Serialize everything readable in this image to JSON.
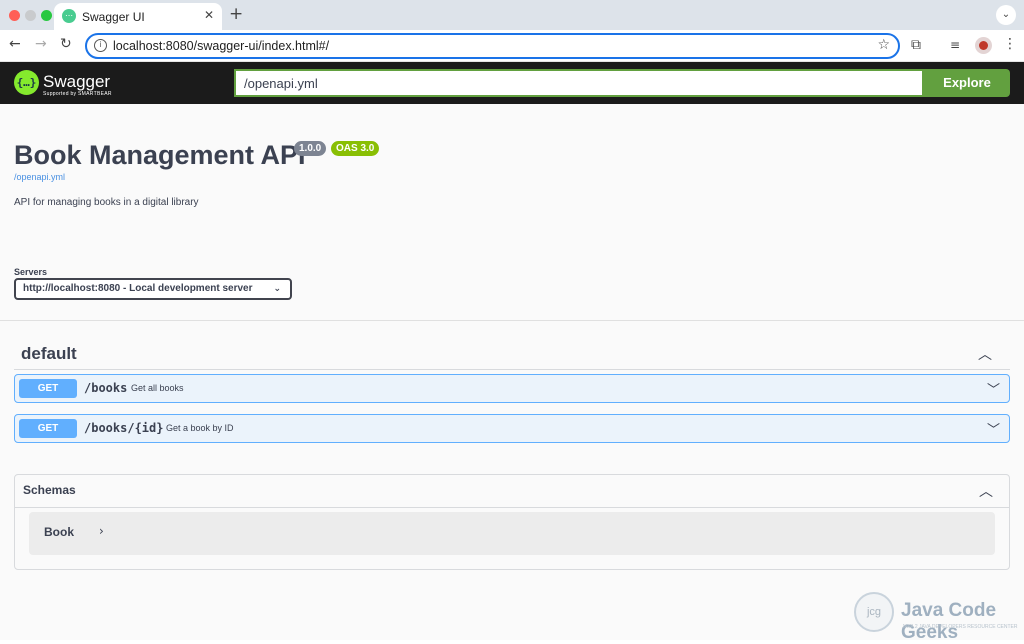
{
  "browser": {
    "tab_title": "Swagger UI",
    "tab_close": "✕",
    "new_tab": "+",
    "tab_menu": "⌄",
    "url": "localhost:8080/swagger-ui/index.html#/",
    "back": "←",
    "forward": "→",
    "reload": "↻",
    "star": "☆",
    "ext_icon": "⧉",
    "media_icon": "≡",
    "menu": "⋮",
    "info_icon": "i"
  },
  "topbar": {
    "logo_mark": "{…}",
    "logo_text": "Swagger",
    "logo_sub": "Supported by SMARTBEAR",
    "spec_url": "/openapi.yml",
    "explore_label": "Explore"
  },
  "info": {
    "title": "Book Management API",
    "version": "1.0.0",
    "oas": "OAS 3.0",
    "spec_link": "/openapi.yml",
    "description": "API for managing books in a digital library"
  },
  "servers": {
    "label": "Servers",
    "selected": "http://localhost:8080 - Local development server",
    "chevron": "⌄"
  },
  "tag": {
    "name": "default",
    "chevron": "︿"
  },
  "operations": [
    {
      "method": "GET",
      "path": "/books",
      "summary": "Get all books",
      "chevron": "﹀"
    },
    {
      "method": "GET",
      "path": "/books/{id}",
      "summary": "Get a book by ID",
      "chevron": "﹀"
    }
  ],
  "schemas": {
    "title": "Schemas",
    "chevron": "︿",
    "models": [
      {
        "name": "Book",
        "arrow": "›"
      }
    ]
  },
  "watermark": {
    "badge": "jcg",
    "text": "Java Code Geeks",
    "sub": "JAVA 2 JAVA DEVELOPERS RESOURCE CENTER"
  },
  "colors": {
    "get_method": "#61affe",
    "swagger_green": "#85ea2d",
    "explore_green": "#62a03f",
    "topbar_bg": "#1b1b1b"
  }
}
